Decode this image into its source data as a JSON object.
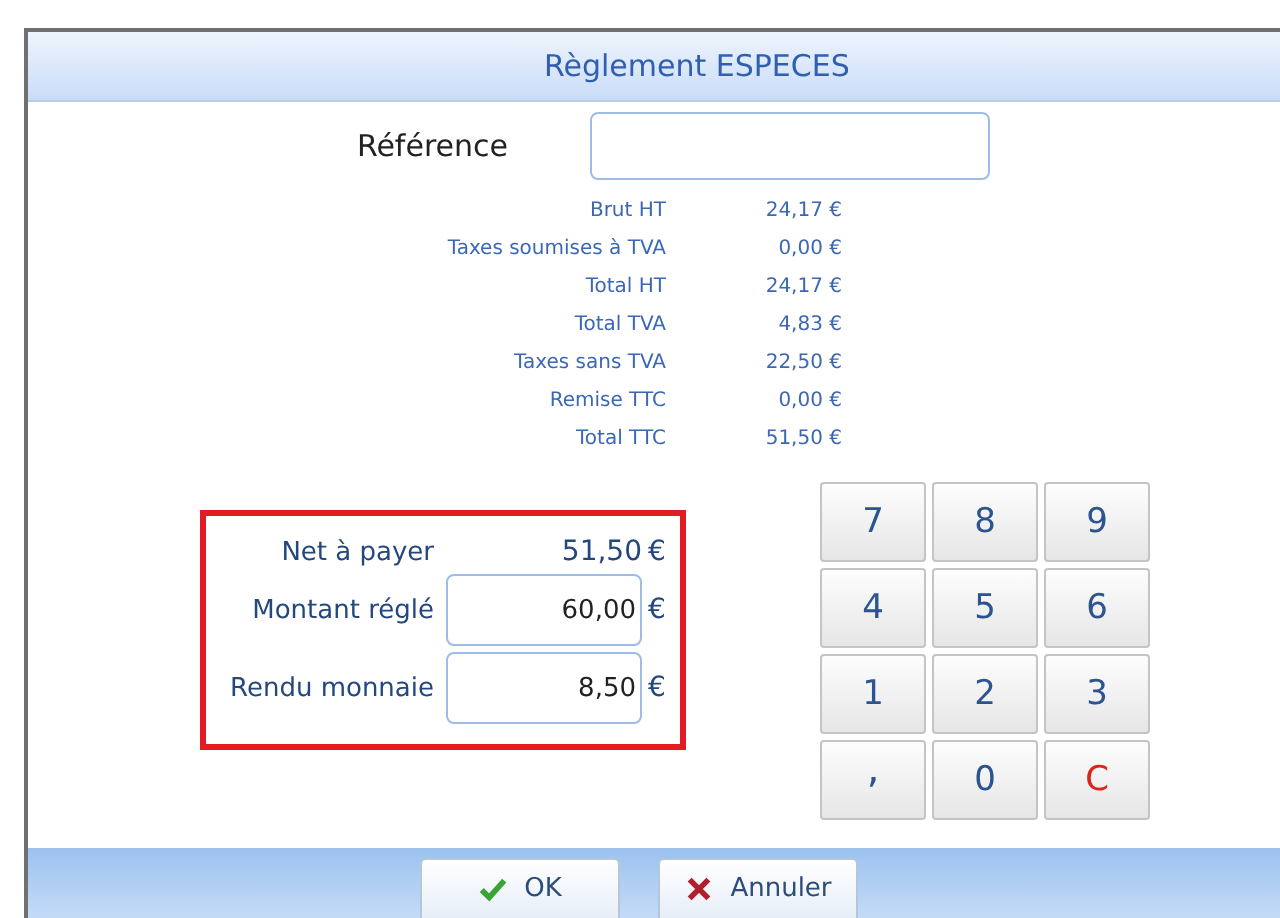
{
  "window": {
    "title": "Règlement ESPECES"
  },
  "reference": {
    "label": "Référence"
  },
  "summary": [
    {
      "label": "Brut HT",
      "value": "24,17 €"
    },
    {
      "label": "Taxes soumises à TVA",
      "value": "0,00 €"
    },
    {
      "label": "Total HT",
      "value": "24,17 €"
    },
    {
      "label": "Total TVA",
      "value": "4,83 €"
    },
    {
      "label": "Taxes sans TVA",
      "value": "22,50 €"
    },
    {
      "label": "Remise TTC",
      "value": "0,00 €"
    },
    {
      "label": "Total TTC",
      "value": "51,50 €"
    }
  ],
  "payment": [
    {
      "kind": "text",
      "label": "Net à payer",
      "value": "51,50",
      "currency": "€"
    },
    {
      "kind": "field",
      "label": "Montant réglé",
      "value": "60,00",
      "currency": "€"
    },
    {
      "kind": "field",
      "label": "Rendu monnaie",
      "value": "8,50",
      "currency": "€"
    }
  ],
  "keypad": [
    {
      "label": "7",
      "kind": "digit"
    },
    {
      "label": "8",
      "kind": "digit"
    },
    {
      "label": "9",
      "kind": "digit"
    },
    {
      "label": "4",
      "kind": "digit"
    },
    {
      "label": "5",
      "kind": "digit"
    },
    {
      "label": "6",
      "kind": "digit"
    },
    {
      "label": "1",
      "kind": "digit"
    },
    {
      "label": "2",
      "kind": "digit"
    },
    {
      "label": "3",
      "kind": "digit"
    },
    {
      "label": ",",
      "kind": "decimal"
    },
    {
      "label": "0",
      "kind": "digit"
    },
    {
      "label": "C",
      "kind": "clear"
    }
  ],
  "buttons": [
    {
      "label": "OK",
      "kind": "ok"
    },
    {
      "label": "Annuler",
      "kind": "cancel"
    }
  ]
}
